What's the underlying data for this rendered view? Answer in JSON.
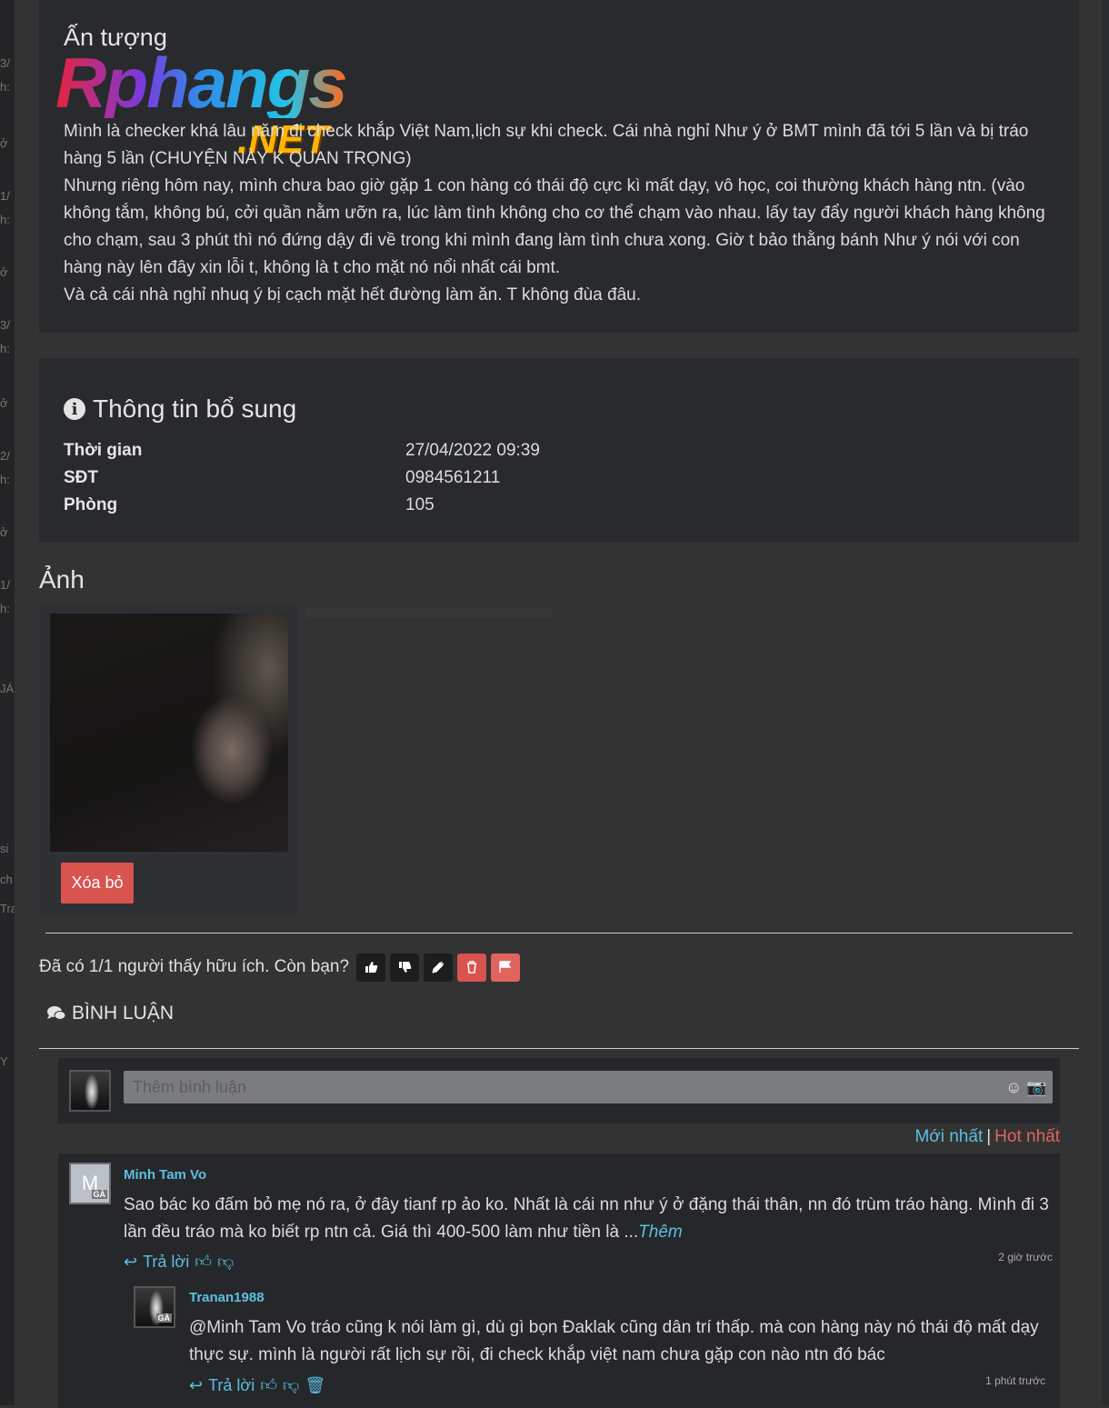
{
  "sidebar_fragments": [
    "3/",
    "h:",
    "ở",
    "1/",
    "h:",
    "ở",
    "3/",
    "h:",
    "ở",
    "2/",
    "h:",
    "ở",
    "1/",
    "h:",
    "JÁ",
    "si",
    "ch",
    "Tra",
    "Y"
  ],
  "story": {
    "heading": "Ấn tượng",
    "logo_brand": "Rphangs",
    "logo_tld": ".NET",
    "paragraphs": [
      "Mình là checker khá lâu năm đi check khắp Việt Nam,lịch sự khi check. Cái nhà nghỉ Như ý ở BMT mình đã tới 5 lần và bị tráo hàng 5 lần (CHUYỆN NÀY K QUAN TRỌNG)",
      "Nhưng riêng hôm nay, mình chưa bao giờ gặp 1 con hàng có thái độ cực kì mất dạy, vô học, coi thường khách hàng ntn. (vào không tắm, không bú, cởi quần nằm ưỡn ra, lúc làm tình không cho cơ thể chạm vào nhau. lấy tay đẩy người khách hàng không cho chạm, sau 3 phút thì nó đứng dậy đi về trong khi mình đang làm tình chưa xong. Giờ t bảo thằng bánh Như ý nói với con hàng này lên đây xin lỗi t, không là t cho mặt nó nổi nhất cái bmt.",
      "Và cả cái nhà nghỉ nhuq ý bị cạch mặt hết đường làm ăn. T không đùa đâu."
    ]
  },
  "info": {
    "title": "Thông tin bổ sung",
    "icon": "info-circle-icon",
    "rows": [
      {
        "key": "Thời gian",
        "value": "27/04/2022 09:39"
      },
      {
        "key": "SĐT",
        "value": "0984561211"
      },
      {
        "key": "Phòng",
        "value": "105"
      }
    ]
  },
  "photos": {
    "title": "Ảnh",
    "delete_label": "Xóa bỏ"
  },
  "helpful": {
    "text": "Đã có 1/1 người thấy hữu ích. Còn bạn?",
    "buttons": [
      "thumbs-up-icon",
      "thumbs-down-icon",
      "pencil-icon",
      "trash-icon",
      "flag-icon"
    ]
  },
  "comments": {
    "title": "BÌNH LUẬN",
    "input_placeholder": "Thêm bình luận",
    "sort_new": "Mới nhất",
    "sort_sep": "|",
    "sort_hot": "Hot nhất",
    "items": [
      {
        "author": "Minh Tam Vo",
        "avatar_letter": "M",
        "badge": "GÀ",
        "text": "Sao bác ko đấm bỏ mẹ nó ra, ở đây tianf rp ảo ko. Nhất là cái nn như ý ở đặng thái thân, nn đó trùm tráo hàng. Mình đi 3 lần đều tráo mà ko biết rp ntn cả. Giá thì 400-500 làm như tiền là ...",
        "more": "Thêm",
        "reply_label": "Trả lời",
        "time": "2 giờ trước"
      },
      {
        "author": "Tranan1988",
        "badge": "GÀ",
        "text": "@Minh Tam Vo tráo cũng k nói làm gì, dù gì bọn Đaklak cũng dân trí thấp. mà con hàng này nó thái độ mất dạy thực sự. mình là người rất lịch sự rồi, đi check khắp việt nam chưa gặp con nào ntn đó bác",
        "reply_label": "Trả lời",
        "time": "1 phút trước"
      }
    ]
  },
  "colors": {
    "background": "#333334",
    "panel": "#282a2e",
    "accent_blue": "#5bc0de",
    "danger_red": "#d9534f"
  }
}
